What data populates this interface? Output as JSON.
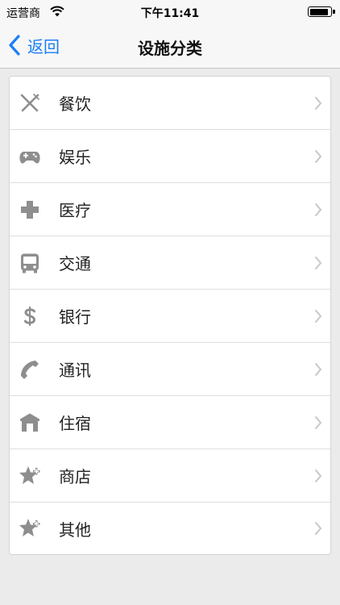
{
  "status_bar": {
    "carrier": "运营商",
    "time": "下午11:41",
    "battery_level": 0.9
  },
  "nav": {
    "back_label": "返回",
    "title": "设施分类"
  },
  "categories": [
    {
      "label": "餐饮",
      "icon": "fork-knife-icon"
    },
    {
      "label": "娱乐",
      "icon": "gamepad-icon"
    },
    {
      "label": "医疗",
      "icon": "medical-cross-icon"
    },
    {
      "label": "交通",
      "icon": "bus-icon"
    },
    {
      "label": "银行",
      "icon": "dollar-icon"
    },
    {
      "label": "通讯",
      "icon": "phone-icon"
    },
    {
      "label": "住宿",
      "icon": "house-icon"
    },
    {
      "label": "商店",
      "icon": "star-plus-icon"
    },
    {
      "label": "其他",
      "icon": "star-plus-icon"
    }
  ],
  "colors": {
    "accent": "#1a7ff5",
    "icon_gray": "#8e8e8e",
    "chevron_gray": "#c7c7cc",
    "background": "#ebebeb"
  }
}
